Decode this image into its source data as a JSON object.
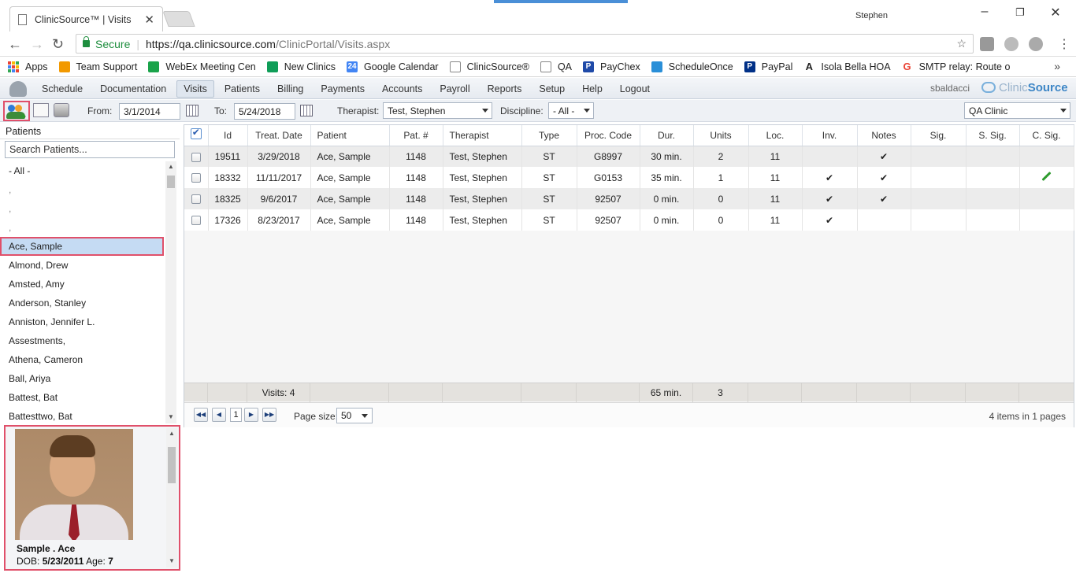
{
  "browser": {
    "tab_title": "ClinicSource™ | Visits",
    "tab_close": "✕",
    "window_user": "Stephen",
    "secure_label": "Secure",
    "url_host": "https://qa.clinicsource.com",
    "url_path": "/ClinicPortal/Visits.aspx",
    "bookmarks": [
      {
        "label": "Apps",
        "icon": "apps-grid-icon",
        "color": "#4285f4"
      },
      {
        "label": "Team Support",
        "icon": "team-support-icon",
        "color": "#f29900"
      },
      {
        "label": "WebEx Meeting Cen",
        "icon": "webex-icon",
        "color": "#1aa34a"
      },
      {
        "label": "New Clinics",
        "icon": "sheet-icon",
        "color": "#0f9d58"
      },
      {
        "label": "Google Calendar",
        "icon": "calendar-icon",
        "color": "#4285f4",
        "badge": "24"
      },
      {
        "label": "ClinicSource®",
        "icon": "page-icon",
        "color": "#888888"
      },
      {
        "label": "QA",
        "icon": "page-icon",
        "color": "#888888"
      },
      {
        "label": "PayChex",
        "icon": "paychex-icon",
        "color": "#1f4aa8",
        "badge": "P"
      },
      {
        "label": "ScheduleOnce",
        "icon": "scheduleonce-icon",
        "color": "#2a8fd8"
      },
      {
        "label": "PayPal",
        "icon": "paypal-icon",
        "color": "#003087",
        "badge": "P"
      },
      {
        "label": "Isola Bella HOA",
        "icon": "font-icon",
        "color": "#222222",
        "badge": "A"
      },
      {
        "label": "SMTP relay: Route o",
        "icon": "google-icon",
        "color": "#ea4335",
        "badge": "G"
      }
    ],
    "more": "»"
  },
  "menu": {
    "items": [
      "Schedule",
      "Documentation",
      "Visits",
      "Patients",
      "Billing",
      "Payments",
      "Accounts",
      "Payroll",
      "Reports",
      "Setup",
      "Help",
      "Logout"
    ],
    "active": "Visits",
    "username": "sbaldacci",
    "brand_a": "Clinic",
    "brand_b": "Source"
  },
  "toolbar": {
    "from_label": "From:",
    "from_value": "3/1/2014",
    "to_label": "To:",
    "to_value": "5/24/2018",
    "therapist_label": "Therapist:",
    "therapist_value": "Test, Stephen",
    "discipline_label": "Discipline:",
    "discipline_value": "- All -",
    "clinic_value": "QA Clinic"
  },
  "patients": {
    "header": "Patients",
    "search_placeholder": "Search Patients...",
    "items": [
      {
        "label": "- All -"
      },
      {
        "label": ","
      },
      {
        "label": ","
      },
      {
        "label": ","
      },
      {
        "label": "Ace, Sample",
        "selected": true
      },
      {
        "label": "Almond, Drew"
      },
      {
        "label": "Amsted, Amy"
      },
      {
        "label": "Anderson, Stanley"
      },
      {
        "label": "Anniston, Jennifer L."
      },
      {
        "label": "Assestments,"
      },
      {
        "label": "Athena, Cameron"
      },
      {
        "label": "Ball, Ariya"
      },
      {
        "label": "Battest, Bat"
      },
      {
        "label": "Battesttwo, Bat"
      }
    ],
    "card": {
      "name": "Sample . Ace",
      "dob_label": "DOB:",
      "dob": "5/23/2011",
      "age_label": "Age:",
      "age": "7"
    }
  },
  "grid": {
    "columns": [
      "Id",
      "Treat. Date",
      "Patient",
      "Pat. #",
      "Therapist",
      "Type",
      "Proc. Code",
      "Dur.",
      "Units",
      "Loc.",
      "Inv.",
      "Notes",
      "Sig.",
      "S. Sig.",
      "C. Sig."
    ],
    "rows": [
      {
        "id": "19511",
        "date": "3/29/2018",
        "patient": "Ace, Sample",
        "patnum": "1148",
        "therapist": "Test, Stephen",
        "type": "ST",
        "proc": "G8997",
        "dur": "30 min.",
        "units": "2",
        "loc": "11",
        "inv": "",
        "notes": "✔",
        "sig": "",
        "ssig": "",
        "csig": false
      },
      {
        "id": "18332",
        "date": "11/11/2017",
        "patient": "Ace, Sample",
        "patnum": "1148",
        "therapist": "Test, Stephen",
        "type": "ST",
        "proc": "G0153",
        "dur": "35 min.",
        "units": "1",
        "loc": "11",
        "inv": "✔",
        "notes": "✔",
        "sig": "",
        "ssig": "",
        "csig": true
      },
      {
        "id": "18325",
        "date": "9/6/2017",
        "patient": "Ace, Sample",
        "patnum": "1148",
        "therapist": "Test, Stephen",
        "type": "ST",
        "proc": "92507",
        "dur": "0 min.",
        "units": "0",
        "loc": "11",
        "inv": "✔",
        "notes": "✔",
        "sig": "",
        "ssig": "",
        "csig": false
      },
      {
        "id": "17326",
        "date": "8/23/2017",
        "patient": "Ace, Sample",
        "patnum": "1148",
        "therapist": "Test, Stephen",
        "type": "ST",
        "proc": "92507",
        "dur": "0 min.",
        "units": "0",
        "loc": "11",
        "inv": "✔",
        "notes": "",
        "sig": "",
        "ssig": "",
        "csig": false
      }
    ],
    "footer": {
      "visits": "Visits: 4",
      "dur": "65 min.",
      "units": "3"
    },
    "pager": {
      "page": "1",
      "page_size_label": "Page size:",
      "page_size": "50",
      "info": "4 items in 1 pages"
    }
  }
}
